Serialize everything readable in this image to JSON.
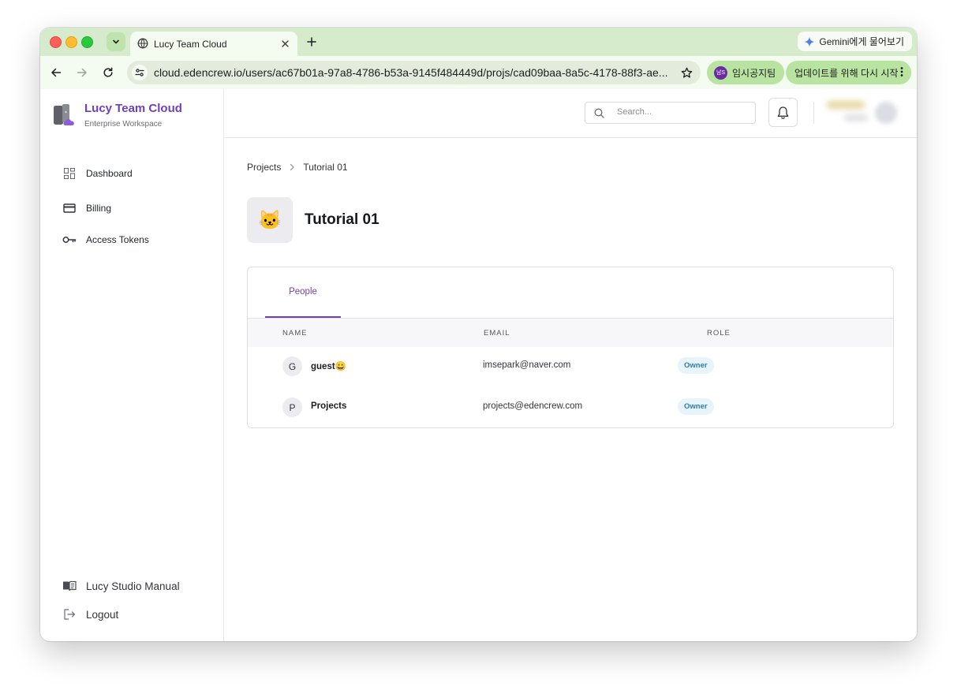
{
  "browser": {
    "tab_title": "Lucy Team Cloud",
    "url": "cloud.edencrew.io/users/ac67b01a-97a8-4786-b53a-9145f484449d/projs/cad09baa-8a5c-4178-88f3-ae...",
    "gemini_label": "Gemini에게 물어보기",
    "profile_initials": "남S",
    "profile_label": "임시공지팀",
    "update_label": "업데이트를 위해 다시 시작"
  },
  "sidebar": {
    "brand_title": "Lucy Team Cloud",
    "brand_subtitle": "Enterprise Workspace",
    "items": [
      {
        "label": "Dashboard",
        "icon": "dashboard-icon"
      },
      {
        "label": "Billing",
        "icon": "credit-card-icon"
      },
      {
        "label": "Access Tokens",
        "icon": "key-icon"
      }
    ],
    "footer": [
      {
        "label": "Lucy Studio Manual",
        "icon": "book-icon"
      },
      {
        "label": "Logout",
        "icon": "logout-icon"
      }
    ]
  },
  "header": {
    "search_placeholder": "Search..."
  },
  "breadcrumb": {
    "parent": "Projects",
    "current": "Tutorial 01"
  },
  "project": {
    "icon": "🐱",
    "title": "Tutorial 01"
  },
  "people": {
    "tab_label": "People",
    "columns": [
      "NAME",
      "EMAIL",
      "ROLE"
    ],
    "rows": [
      {
        "initial": "G",
        "name": "guest😀",
        "email": "imsepark@naver.com",
        "role": "Owner"
      },
      {
        "initial": "P",
        "name": "Projects",
        "email": "projects@edencrew.com",
        "role": "Owner"
      }
    ]
  },
  "colors": {
    "accent": "#7040b8",
    "badge_bg": "#e8f4fb",
    "badge_text": "#2a7fb3",
    "browser_frame": "#d6ebcc"
  }
}
